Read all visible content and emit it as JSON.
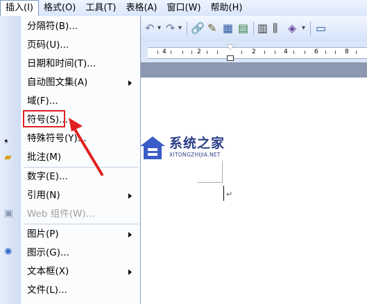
{
  "menubar": {
    "items": [
      {
        "label": "插入(I)",
        "active": true
      },
      {
        "label": "格式(O)"
      },
      {
        "label": "工具(T)"
      },
      {
        "label": "表格(A)"
      },
      {
        "label": "窗口(W)"
      },
      {
        "label": "帮助(H)"
      }
    ]
  },
  "ruler": {
    "labels": [
      "4",
      "2",
      "2",
      "4",
      "6",
      "8"
    ]
  },
  "insert_menu": {
    "items": [
      {
        "label": "分隔符(B)...",
        "submenu": false
      },
      {
        "label": "页码(U)...",
        "submenu": false
      },
      {
        "label": "日期和时间(T)...",
        "submenu": false
      },
      {
        "label": "自动图文集(A)",
        "submenu": true
      },
      {
        "label": "域(F)...",
        "submenu": false
      },
      {
        "label": "符号(S)...",
        "submenu": false,
        "highlighted": true
      },
      {
        "label": "特殊符号(Y)...",
        "submenu": false
      },
      {
        "label": "批注(M)",
        "submenu": false
      },
      {
        "label": "数字(E)...",
        "submenu": false
      },
      {
        "label": "引用(N)",
        "submenu": true
      },
      {
        "label": "Web 组件(W)...",
        "submenu": false,
        "disabled": true
      },
      {
        "label": "图片(P)",
        "submenu": true
      },
      {
        "label": "图示(G)...",
        "submenu": false
      },
      {
        "label": "文本框(X)",
        "submenu": true
      },
      {
        "label": "文件(L)...",
        "submenu": false
      }
    ]
  },
  "document": {
    "paragraph_mark": "↵"
  },
  "watermark": {
    "title": "系统之家",
    "subtitle": "XITONGZHIJIA.NET"
  },
  "colors": {
    "highlight_box": "#e02020",
    "arrow": "#e02020",
    "watermark": "#2a3e86"
  }
}
